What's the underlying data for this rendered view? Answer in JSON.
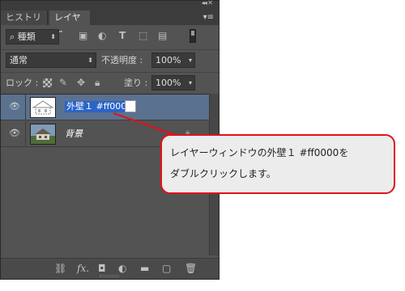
{
  "panel": {
    "tabs": [
      {
        "label": "ヒストリー"
      },
      {
        "label": "レイヤー"
      }
    ],
    "filter": {
      "label": "種類",
      "icons": [
        "image-filter-icon",
        "adjustment-filter-icon",
        "text-filter-icon",
        "shape-filter-icon",
        "smart-object-filter-icon"
      ]
    },
    "blend": {
      "mode": "通常",
      "opacity_label": "不透明度 :",
      "opacity_value": "100%"
    },
    "lock": {
      "label": "ロック :",
      "fill_label": "塗り :",
      "fill_value": "100%"
    },
    "layers": [
      {
        "name": "外壁１ #ff0000",
        "selected": true,
        "visible": true
      },
      {
        "name": "背景",
        "selected": false,
        "visible": true,
        "locked": true
      }
    ],
    "bottom_icons": [
      "link-icon",
      "fx-icon",
      "mask-icon",
      "adjustment-icon",
      "folder-icon",
      "new-layer-icon",
      "trash-icon"
    ]
  },
  "callout": {
    "line1": "レイヤーウィンドウの外壁１ #ff0000を",
    "line2": "ダブルクリックします。",
    "color": "#e0121c"
  }
}
